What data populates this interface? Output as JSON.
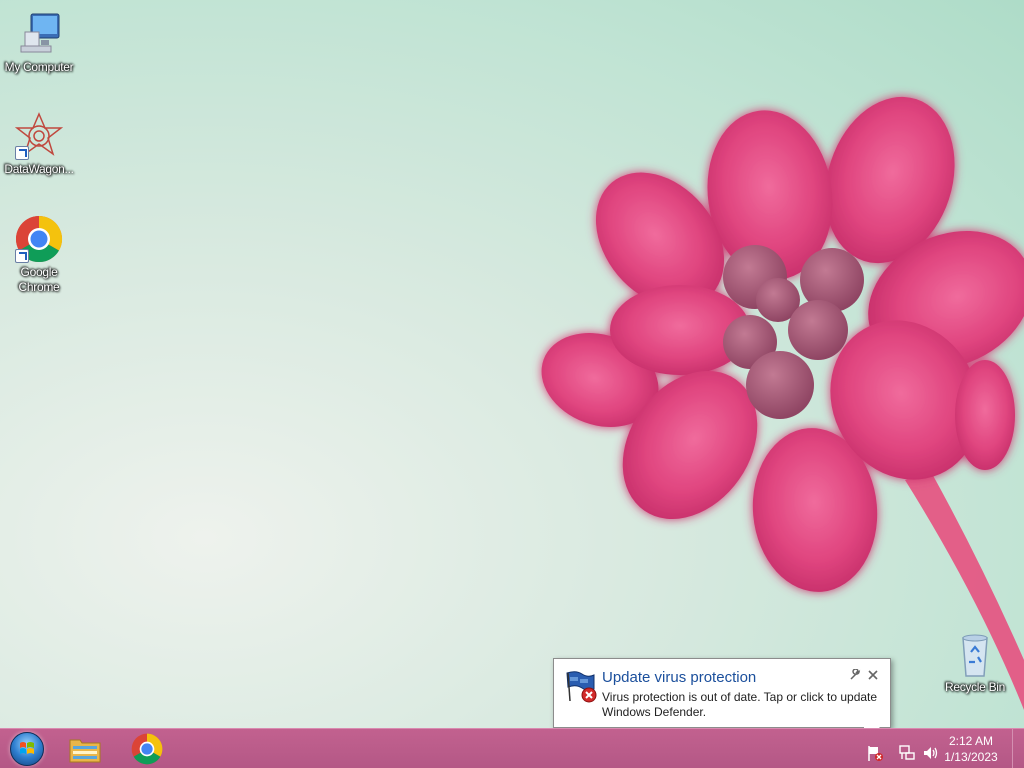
{
  "desktop": {
    "icons": [
      {
        "label": "My Computer",
        "icon": "computer-icon"
      },
      {
        "label": "DataWagon...",
        "icon": "datawagon-icon",
        "shortcut": true
      },
      {
        "label": "Google\nChrome",
        "label_line1": "Google",
        "label_line2": "Chrome",
        "icon": "chrome-icon",
        "shortcut": true
      },
      {
        "label": "Recycle Bin",
        "icon": "recycle-bin-icon"
      }
    ]
  },
  "notification": {
    "title": "Update virus protection",
    "message": "Virus protection is out of date. Tap or click to update Windows Defender.",
    "options_icon": "wrench-icon",
    "close_icon": "close-icon"
  },
  "taskbar": {
    "start": "start-orb-icon",
    "pinned": [
      {
        "name": "windows-explorer-icon"
      },
      {
        "name": "chrome-icon"
      }
    ],
    "tray_icons": [
      "action-center-flag-icon",
      "network-icon",
      "volume-icon"
    ],
    "clock": {
      "time": "2:12 AM",
      "date": "1/13/2023"
    }
  },
  "colors": {
    "taskbar": "#b45886",
    "balloon_title": "#1b4f9c",
    "petal": "#e0457f"
  }
}
